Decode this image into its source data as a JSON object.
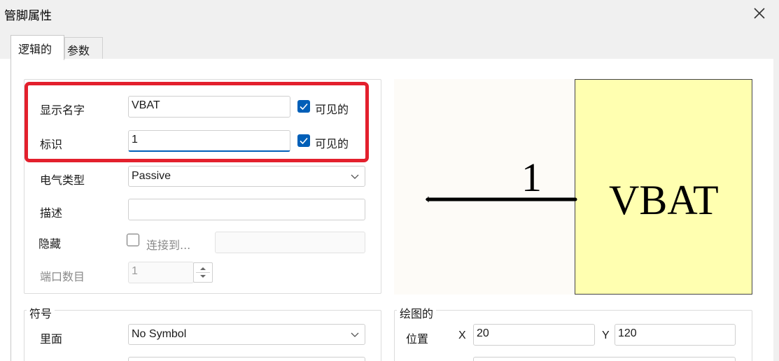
{
  "window": {
    "title": "管脚属性",
    "close_icon": "close-icon"
  },
  "tabs": [
    {
      "label": "逻辑的",
      "active": true
    },
    {
      "label": "参数",
      "active": false
    }
  ],
  "logical": {
    "display_name": {
      "label": "显示名字",
      "value": "VBAT",
      "visible_label": "可见的",
      "visible_checked": true
    },
    "designator": {
      "label": "标识",
      "value": "1",
      "visible_label": "可见的",
      "visible_checked": true
    },
    "electrical_type": {
      "label": "电气类型",
      "value": "Passive"
    },
    "description": {
      "label": "描述",
      "value": ""
    },
    "hidden": {
      "label": "隐藏",
      "checked": false,
      "connect_to_label": "连接到...",
      "connect_to_value": ""
    },
    "port_count": {
      "label": "端口数目",
      "value": "1"
    }
  },
  "symbol_group": {
    "title": "符号",
    "inside": {
      "label": "里面",
      "value": "No Symbol"
    }
  },
  "drawing_group": {
    "title": "绘图的",
    "location": {
      "label": "位置",
      "x_label": "X",
      "x_value": "20",
      "y_label": "Y",
      "y_value": "120"
    }
  },
  "preview": {
    "pin_name": "VBAT",
    "pin_number": "1",
    "body_color": "#ffffb0",
    "background_color": "#fdfbf7"
  },
  "colors": {
    "accent": "#005fb8",
    "highlight": "#e3202d"
  }
}
